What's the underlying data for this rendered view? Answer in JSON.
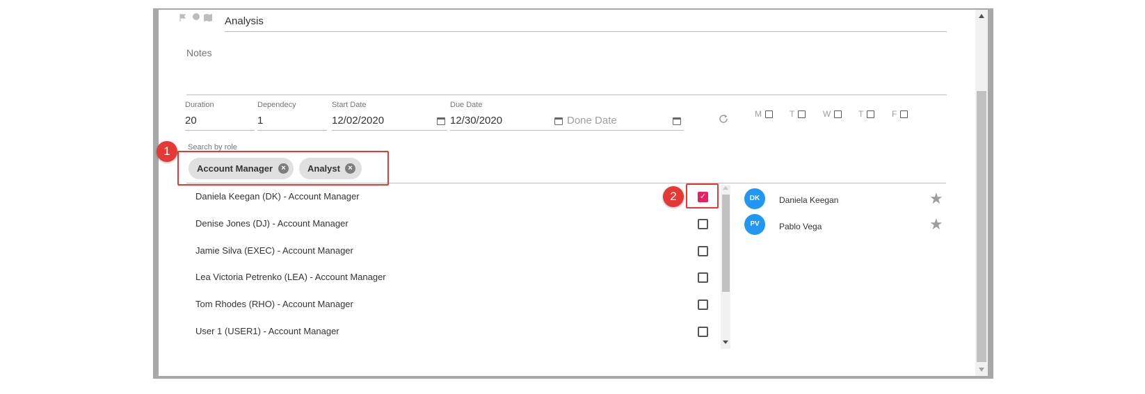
{
  "task": {
    "name": "Analysis",
    "notes_placeholder": "Notes"
  },
  "fields": {
    "duration": {
      "label": "Duration",
      "value": "20"
    },
    "dependency": {
      "label": "Dependecy",
      "value": "1"
    },
    "start_date": {
      "label": "Start Date",
      "value": "12/02/2020"
    },
    "due_date": {
      "label": "Due Date",
      "value": "12/30/2020"
    },
    "done_date": {
      "placeholder": "Done Date"
    }
  },
  "days": [
    {
      "label": "M",
      "checked": false
    },
    {
      "label": "T",
      "checked": false
    },
    {
      "label": "W",
      "checked": false
    },
    {
      "label": "T",
      "checked": false
    },
    {
      "label": "F",
      "checked": false
    }
  ],
  "role_search": {
    "label": "Search by role",
    "chips": [
      "Account Manager",
      "Analyst"
    ]
  },
  "users": [
    {
      "label": "Daniela Keegan (DK) - Account Manager",
      "checked": true
    },
    {
      "label": "Denise Jones (DJ) - Account Manager",
      "checked": false
    },
    {
      "label": "Jamie Silva (EXEC) - Account Manager",
      "checked": false
    },
    {
      "label": "Lea Victoria Petrenko (LEA) - Account Manager",
      "checked": false
    },
    {
      "label": "Tom Rhodes (RHO) - Account Manager",
      "checked": false
    },
    {
      "label": "User 1 (USER1) - Account Manager",
      "checked": false
    }
  ],
  "assigned": [
    {
      "initials": "DK",
      "name": "Daniela Keegan"
    },
    {
      "initials": "PV",
      "name": "Pablo Vega"
    }
  ],
  "callouts": [
    "1",
    "2"
  ],
  "colors": {
    "accent": "#e91e63",
    "avatar": "#2196f3",
    "callout": "#e53935"
  }
}
